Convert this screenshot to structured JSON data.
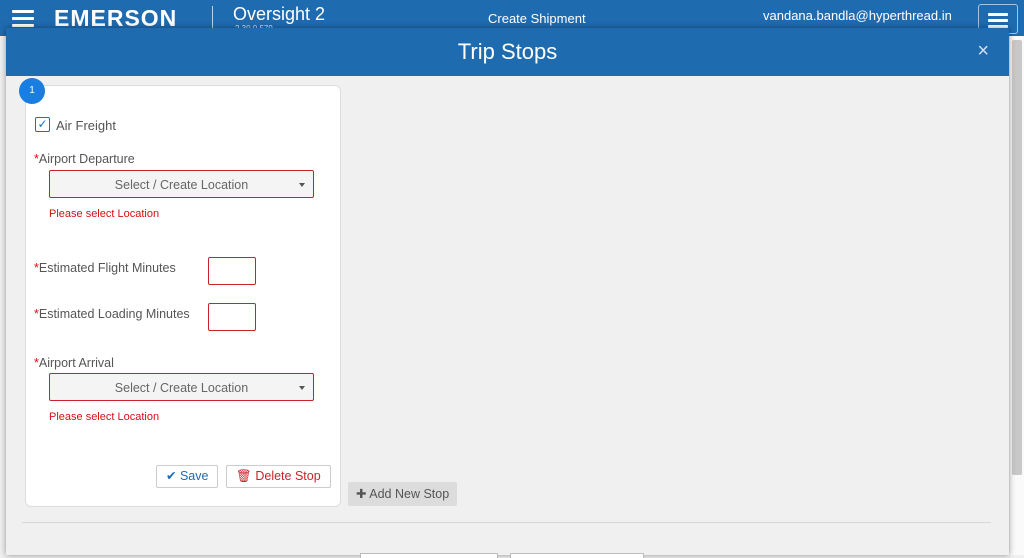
{
  "app": {
    "logo": "EMERSON",
    "name": "Oversight 2",
    "version": "2.30.0.579",
    "page_title": "Create Shipment",
    "user": "vandana.bandla@hyperthread.in"
  },
  "modal": {
    "title": "Trip Stops",
    "close_symbol": "×"
  },
  "stop": {
    "number": "1",
    "air_freight": {
      "label": "Air Freight",
      "checked": true
    },
    "required_marker": "*",
    "airport_departure": {
      "label": "Airport Departure",
      "placeholder": "Select / Create Location",
      "error": "Please select Location"
    },
    "flight_minutes": {
      "label": "Estimated Flight Minutes",
      "value": ""
    },
    "loading_minutes": {
      "label": "Estimated Loading Minutes",
      "value": ""
    },
    "airport_arrival": {
      "label": "Airport Arrival",
      "placeholder": "Select / Create Location",
      "error": "Please select Location"
    },
    "save_label": "Save",
    "delete_label": "Delete Stop"
  },
  "add_stop_label": "Add New Stop",
  "colors": {
    "primary": "#1f6bb0",
    "error": "#d41010",
    "badge": "#1a7de0"
  },
  "icons": {
    "menu": "menu-icon",
    "close": "close-icon",
    "check": "checkmark-icon",
    "save": "check-icon",
    "delete": "trash-icon",
    "add": "plus-icon",
    "caret": "caret-down-icon"
  }
}
